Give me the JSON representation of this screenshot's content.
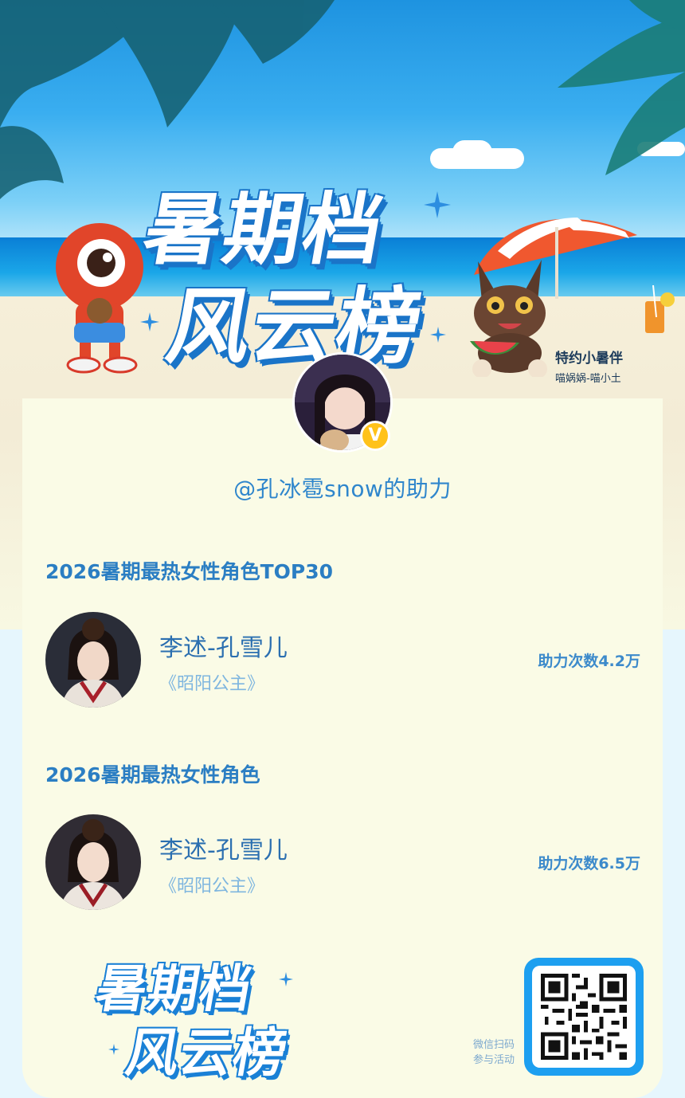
{
  "hero": {
    "title_line1": "暑期档",
    "title_line2": "风云榜",
    "sponsor_title": "特约小暑伴",
    "sponsor_names": "喵娲娲-喵小土"
  },
  "profile": {
    "handle": "@孔冰雹snow的助力",
    "badge_letter": "V"
  },
  "sections": [
    {
      "title": "2026暑期最热女性角色TOP30",
      "name": "李述-孔雪儿",
      "work": "《昭阳公主》",
      "count": "助力次数4.2万"
    },
    {
      "title": "2026暑期最热女性角色",
      "name": "李述-孔雪儿",
      "work": "《昭阳公主》",
      "count": "助力次数6.5万"
    }
  ],
  "footer": {
    "logo_line1": "暑期档",
    "logo_line2": "风云榜",
    "qr_line1": "微信扫码",
    "qr_line2": "参与活动"
  },
  "colors": {
    "accent": "#2b7ec3",
    "card_bg": "#fafbe6",
    "qr_frame": "#1d9ff0",
    "badge": "#ffc21a"
  }
}
